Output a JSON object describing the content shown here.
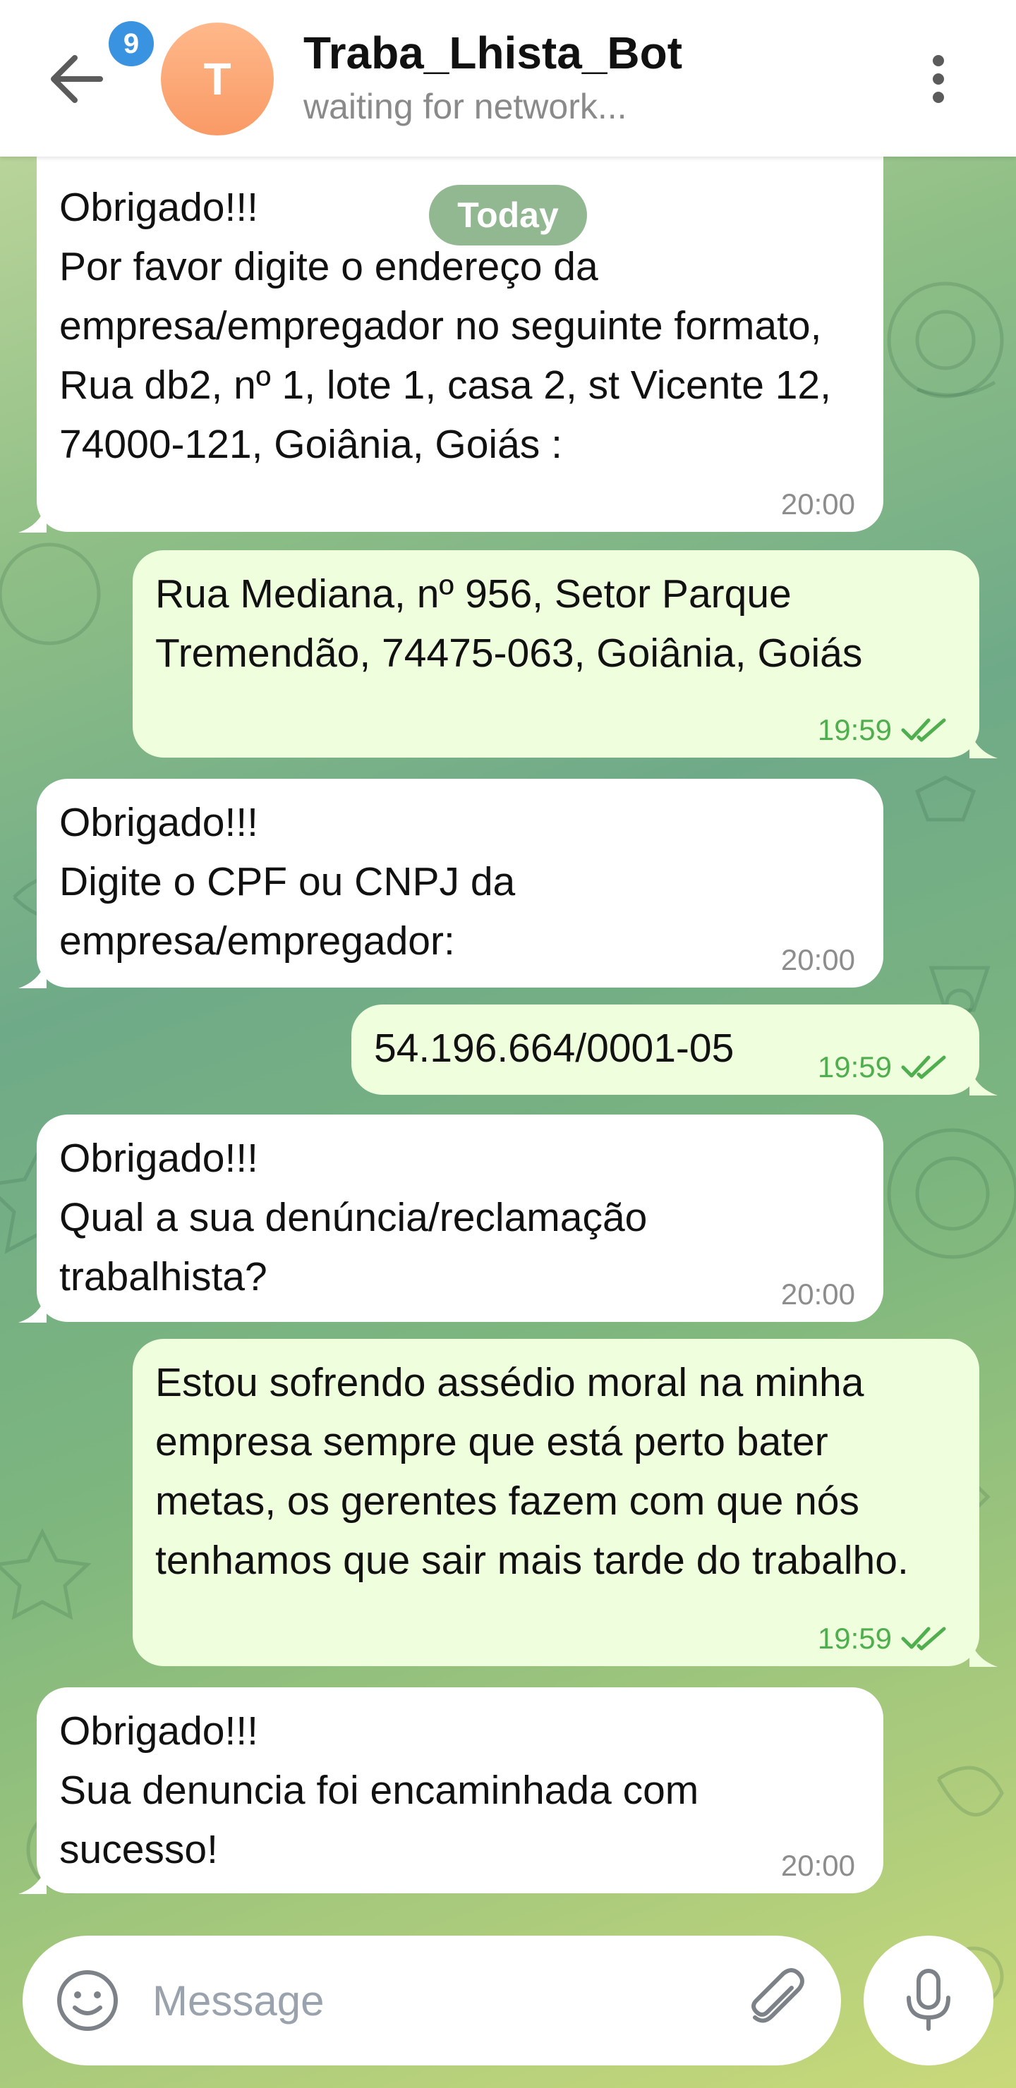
{
  "header": {
    "unread_count": "9",
    "avatar_letter": "T",
    "title": "Traba_Lhista_Bot",
    "status": "waiting for network..."
  },
  "date_chip": "Today",
  "messages": [
    {
      "direction": "in",
      "text": "Obrigado!!!\nPor favor digite o endereço da empresa/empregador no seguinte formato, Rua db2, nº 1, lote 1, casa 2, st Vicente 12, 74000-121, Goiânia, Goiás :",
      "time": "20:00"
    },
    {
      "direction": "out",
      "text": "Rua Mediana, nº 956, Setor Parque Tremendão, 74475-063, Goiânia, Goiás",
      "time": "19:59"
    },
    {
      "direction": "in",
      "text": "Obrigado!!!\nDigite o CPF ou CNPJ da empresa/empregador:",
      "time": "20:00"
    },
    {
      "direction": "out",
      "text": "54.196.664/0001-05",
      "time": "19:59"
    },
    {
      "direction": "in",
      "text": "Obrigado!!!\nQual a sua denúncia/reclamação trabalhista?",
      "time": "20:00"
    },
    {
      "direction": "out",
      "text": "Estou sofrendo assédio moral na minha empresa sempre que está perto bater metas, os gerentes fazem com que nós tenhamos que sair mais tarde do trabalho.",
      "time": "19:59"
    },
    {
      "direction": "in",
      "text": "Obrigado!!!\nSua denuncia foi encaminhada com sucesso!",
      "time": "20:00"
    }
  ],
  "composer": {
    "placeholder": "Message"
  },
  "colors": {
    "incoming_bubble": "#ffffff",
    "outgoing_bubble": "#effedd",
    "read_check": "#4fae4e",
    "badge": "#3a93e0",
    "avatar": "#f99a66"
  },
  "icons": [
    "back-arrow-icon",
    "more-vert-icon",
    "emoji-icon",
    "paperclip-icon",
    "microphone-icon",
    "double-check-icon"
  ]
}
